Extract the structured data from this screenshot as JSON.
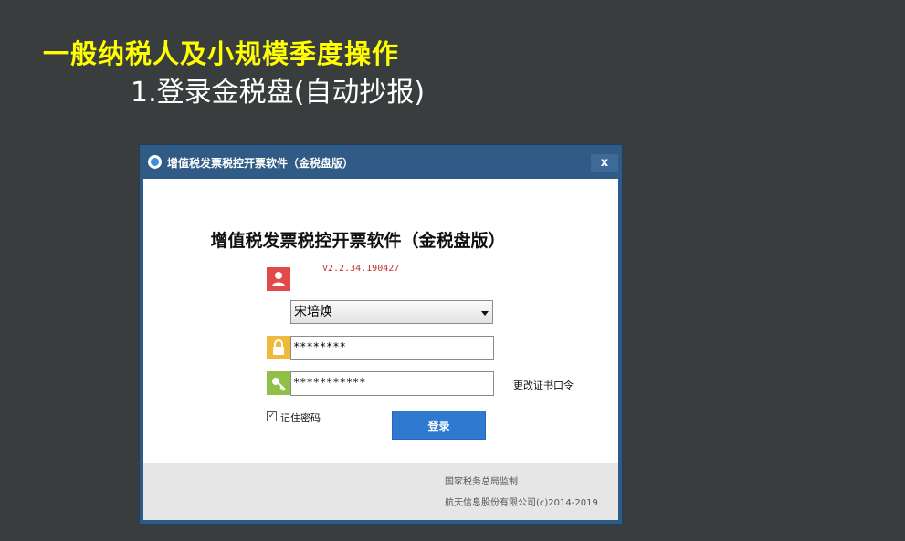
{
  "slide": {
    "title": "一般纳税人及小规模季度操作",
    "subtitle": "1.登录金税盘(自动抄报)"
  },
  "window": {
    "titlebar_text": "增值税发票税控开票软件（金税盘版）",
    "close_label": "x"
  },
  "app": {
    "heading": "增值税发票税控开票软件（金税盘版）",
    "version": "V2.2.34.190427"
  },
  "login": {
    "user_value": "宋培焕",
    "password_value": "********",
    "cert_password_value": "***********",
    "change_cert_link": "更改证书口令",
    "remember_label": "记住密码",
    "remember_checked": true,
    "login_button": "登录"
  },
  "footer": {
    "supervisor": "国家税务总局监制",
    "copyright": "航天信息股份有限公司(c)2014-2019"
  },
  "colors": {
    "accent_title": "#ffff00",
    "user_icon_bg": "#e04a4a",
    "lock_icon_bg": "#f0b93a",
    "key_icon_bg": "#90c046",
    "login_button_bg": "#2f7ad0"
  },
  "icons": {
    "app": "app-logo-icon",
    "user": "user-icon",
    "password": "lock-icon",
    "cert": "key-icon",
    "dropdown": "chevron-down-icon"
  }
}
